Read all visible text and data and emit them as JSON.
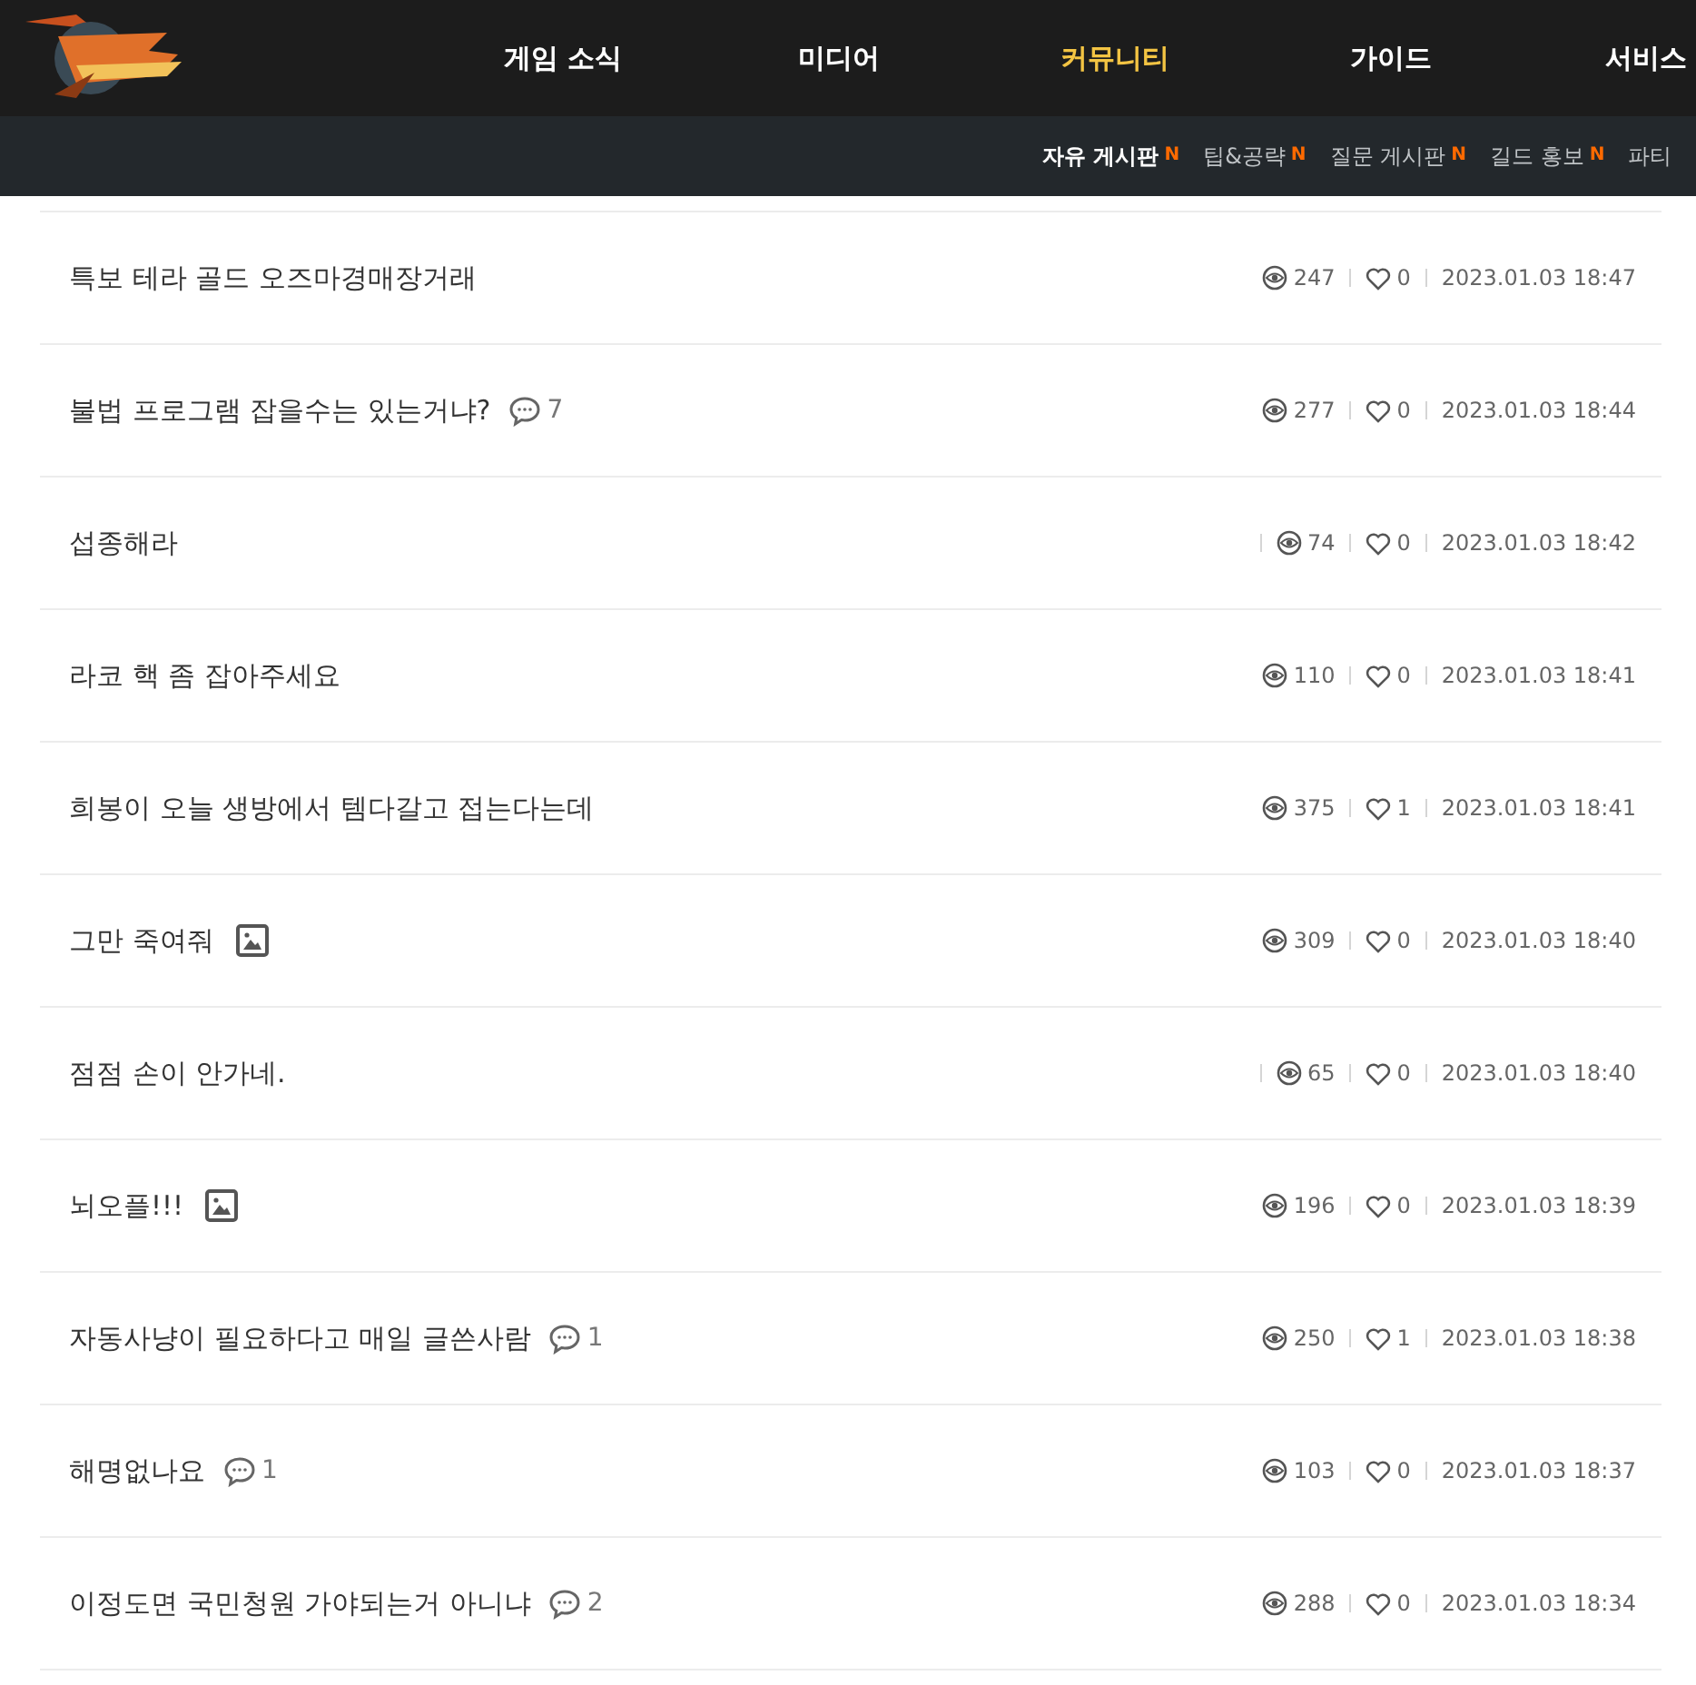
{
  "header": {
    "nav": [
      {
        "label": "게임 소식",
        "selected": false
      },
      {
        "label": "미디어",
        "selected": false
      },
      {
        "label": "커뮤니티",
        "selected": true
      },
      {
        "label": "가이드",
        "selected": false
      },
      {
        "label": "서비스",
        "selected": false
      }
    ],
    "subnav": [
      {
        "label": "자유 게시판",
        "selected": true,
        "badge": "N"
      },
      {
        "label": "팁&공략",
        "selected": false,
        "badge": "N"
      },
      {
        "label": "질문 게시판",
        "selected": false,
        "badge": "N"
      },
      {
        "label": "길드 홍보",
        "selected": false,
        "badge": "N"
      },
      {
        "label": "파티",
        "selected": false
      }
    ]
  },
  "posts": [
    {
      "title": "특보 테라 골드 오즈마경매장거래",
      "views": "247",
      "likes": "0",
      "date": "2023.01.03 18:47"
    },
    {
      "title": "불법 프로그램 잡을수는 있는거냐?",
      "comments": "7",
      "views": "277",
      "likes": "0",
      "date": "2023.01.03 18:44"
    },
    {
      "title": "섭종해라",
      "divider": true,
      "views": "74",
      "likes": "0",
      "date": "2023.01.03 18:42"
    },
    {
      "title": "라코 핵 좀 잡아주세요",
      "views": "110",
      "likes": "0",
      "date": "2023.01.03 18:41"
    },
    {
      "title": "희봉이 오늘 생방에서 템다갈고 접는다는데",
      "views": "375",
      "likes": "1",
      "date": "2023.01.03 18:41"
    },
    {
      "title": "그만 죽여줘",
      "image": true,
      "views": "309",
      "likes": "0",
      "date": "2023.01.03 18:40"
    },
    {
      "title": "점점 손이 안가네.",
      "divider": true,
      "views": "65",
      "likes": "0",
      "date": "2023.01.03 18:40"
    },
    {
      "title": "뇌오플!!!",
      "image": true,
      "views": "196",
      "likes": "0",
      "date": "2023.01.03 18:39"
    },
    {
      "title": "자동사냥이 필요하다고 매일 글쓴사람",
      "comments": "1",
      "views": "250",
      "likes": "1",
      "date": "2023.01.03 18:38"
    },
    {
      "title": "해명없나요",
      "comments": "1",
      "views": "103",
      "likes": "0",
      "date": "2023.01.03 18:37"
    },
    {
      "title": "이정도면 국민청원 가야되는거 아니냐",
      "comments": "2",
      "views": "288",
      "likes": "0",
      "date": "2023.01.03 18:34"
    }
  ]
}
